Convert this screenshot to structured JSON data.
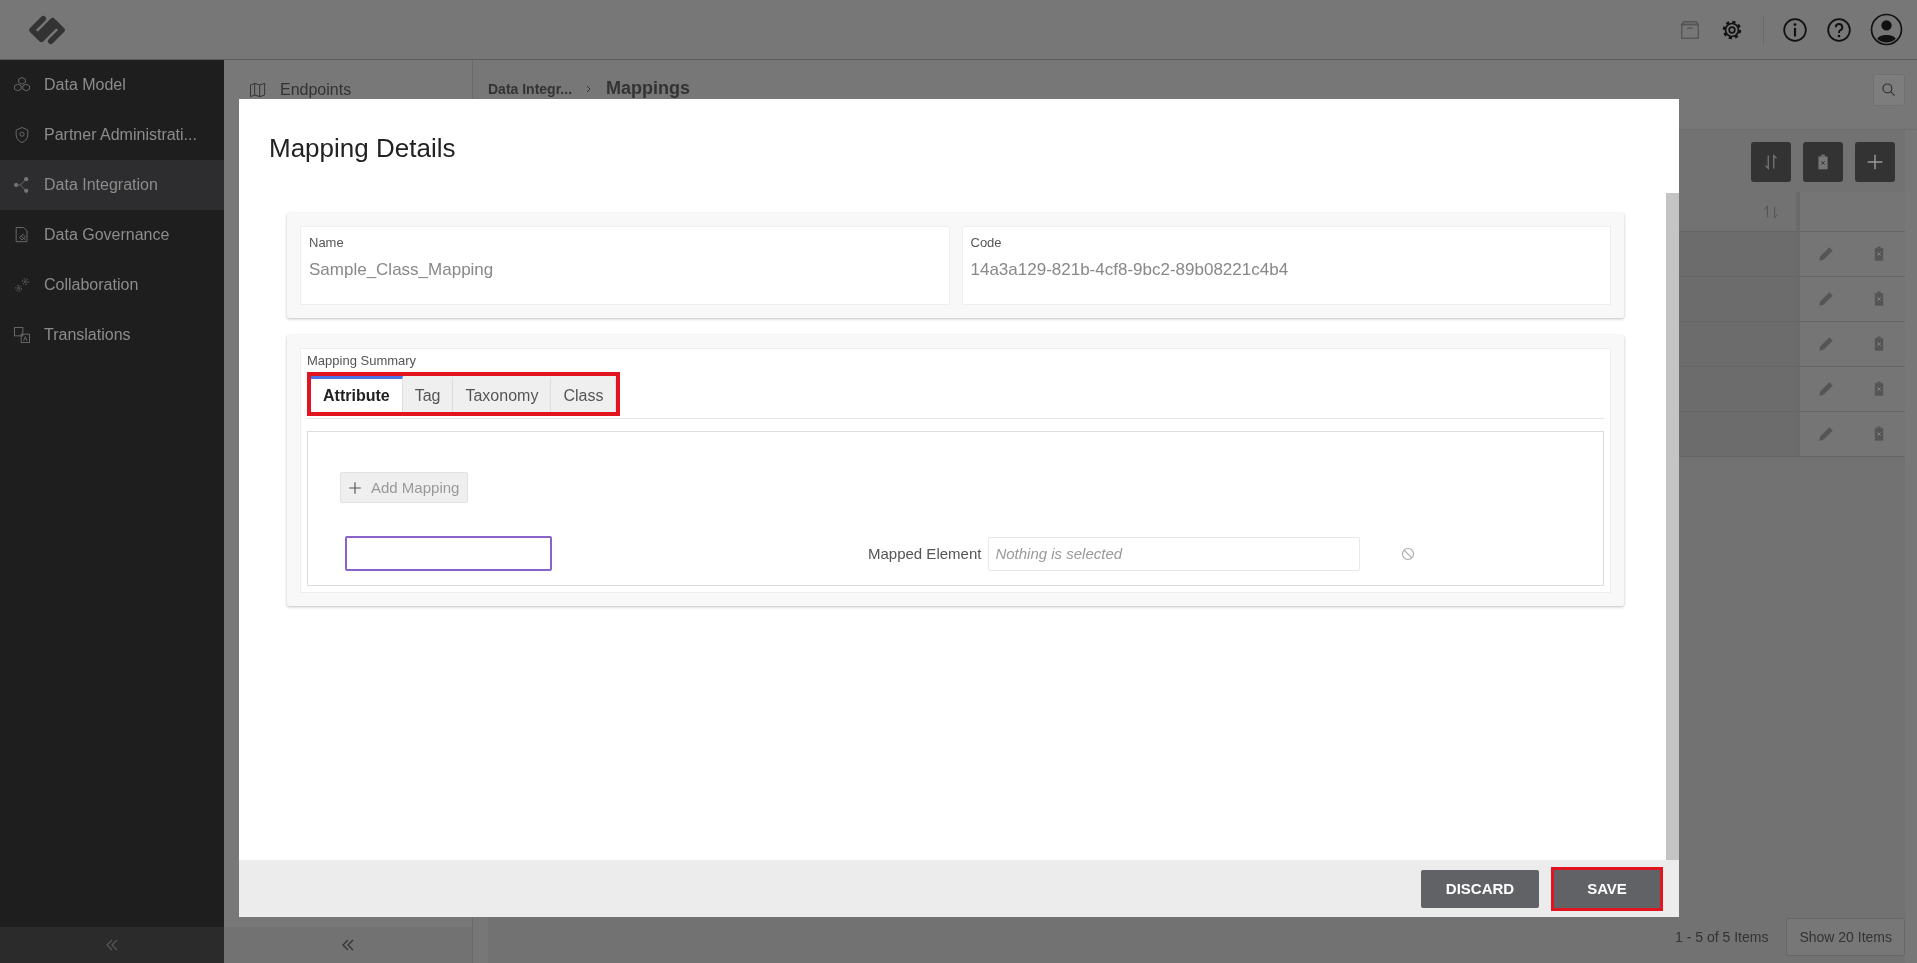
{
  "sidebar": {
    "items": [
      {
        "label": "Data Model",
        "selected": false
      },
      {
        "label": "Partner Administrati...",
        "selected": false
      },
      {
        "label": "Data Integration",
        "selected": true
      },
      {
        "label": "Data Governance",
        "selected": false
      },
      {
        "label": "Collaboration",
        "selected": false
      },
      {
        "label": "Translations",
        "selected": false
      }
    ]
  },
  "subpanel": {
    "items": [
      {
        "label": "Endpoints"
      }
    ]
  },
  "breadcrumb": [
    {
      "label": "Data Integr..."
    },
    {
      "label": "Mappings"
    }
  ],
  "pagination": {
    "summary": "1 - 5 of 5 Items",
    "page_size": "Show 20 Items"
  },
  "dialog": {
    "title": "Mapping Details",
    "fields": [
      {
        "label": "Name",
        "value": "Sample_Class_Mapping"
      },
      {
        "label": "Code",
        "value": "14a3a129-821b-4cf8-9bc2-89b08221c4b4"
      }
    ],
    "summary": {
      "title": "Mapping Summary",
      "highlighted": true,
      "tabs": [
        {
          "label": "Attribute",
          "selected": true
        },
        {
          "label": "Tag",
          "selected": false
        },
        {
          "label": "Taxonomy",
          "selected": false
        },
        {
          "label": "Class",
          "selected": false
        }
      ],
      "add_button": "Add Mapping",
      "source_input": {
        "focused": true
      },
      "mapped_element": {
        "label": "Mapped Element",
        "placeholder": "Nothing is selected"
      }
    },
    "buttons": [
      {
        "label": "DISCARD",
        "highlighted": false
      },
      {
        "label": "SAVE",
        "highlighted": true
      }
    ]
  }
}
